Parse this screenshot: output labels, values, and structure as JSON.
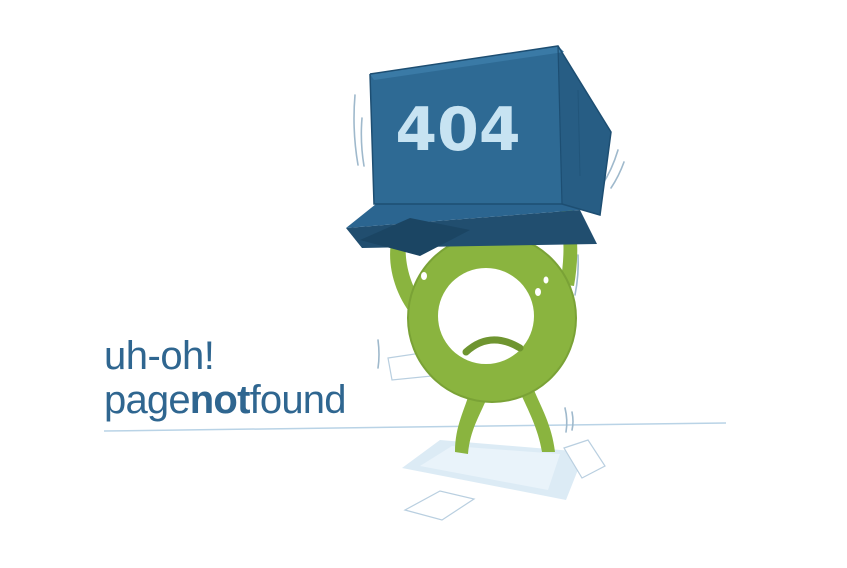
{
  "error": {
    "code": "404",
    "headline": "uh-oh!",
    "subline_prefix": "page",
    "subline_emphasis": "not",
    "subline_suffix": "found"
  },
  "illustration": {
    "description_icon": "monster-holding-box-icon"
  },
  "colors": {
    "text": "#2f6690",
    "box": "#2e6a94",
    "box_dark": "#214e6f",
    "box_code": "#c7e3f2",
    "monster": "#8ab43f",
    "monster_dark": "#6f9530",
    "floor_line": "#b9d3e6",
    "shadow": "#dcebf5"
  }
}
